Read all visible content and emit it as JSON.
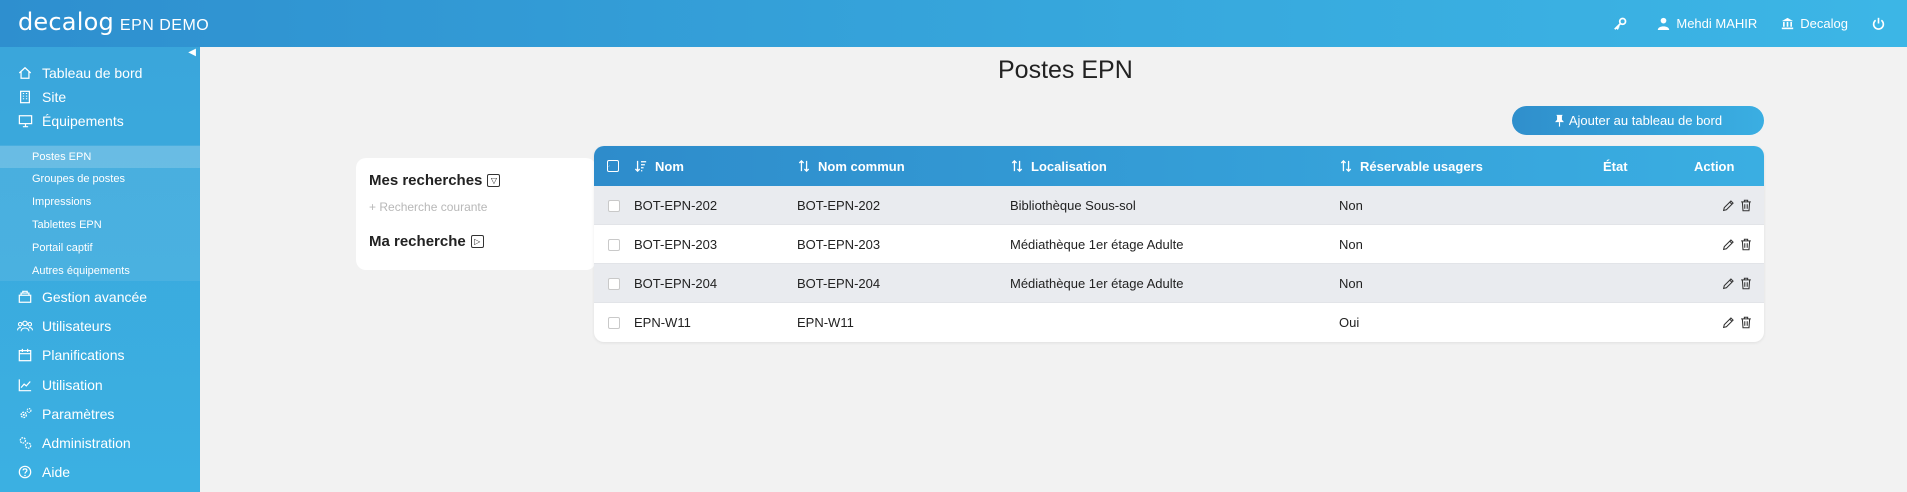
{
  "header": {
    "logo": "decalog",
    "app_name": "EPN DEMO",
    "user": "Mehdi MAHIR",
    "library": "Decalog"
  },
  "sidebar": {
    "items": [
      {
        "label": "Tableau de bord",
        "icon": "home-icon"
      },
      {
        "label": "Site",
        "icon": "building-icon"
      },
      {
        "label": "Équipements",
        "icon": "monitor-icon"
      },
      {
        "label": "Gestion avancée",
        "icon": "layers-icon"
      },
      {
        "label": "Utilisateurs",
        "icon": "users-icon"
      },
      {
        "label": "Planifications",
        "icon": "calendar-icon"
      },
      {
        "label": "Utilisation",
        "icon": "chart-icon"
      },
      {
        "label": "Paramètres",
        "icon": "gears-icon"
      },
      {
        "label": "Administration",
        "icon": "admin-gears-icon"
      },
      {
        "label": "Aide",
        "icon": "help-icon"
      }
    ],
    "subitems": [
      {
        "label": "Postes EPN",
        "active": true
      },
      {
        "label": "Groupes de postes"
      },
      {
        "label": "Impressions"
      },
      {
        "label": "Tablettes EPN"
      },
      {
        "label": "Portail captif"
      },
      {
        "label": "Autres équipements"
      }
    ]
  },
  "main": {
    "title": "Postes EPN",
    "pin_button": "Ajouter au tableau de bord",
    "searches": {
      "mine": "Mes recherches",
      "current": "Recherche courante",
      "my_search": "Ma recherche"
    },
    "table": {
      "columns": [
        "Nom",
        "Nom commun",
        "Localisation",
        "Réservable usagers",
        "État",
        "Action"
      ],
      "rows": [
        {
          "nom": "BOT-EPN-202",
          "nom_commun": "BOT-EPN-202",
          "localisation": "Bibliothèque Sous-sol",
          "reservable": "Non",
          "etat": ""
        },
        {
          "nom": "BOT-EPN-203",
          "nom_commun": "BOT-EPN-203",
          "localisation": "Médiathèque 1er étage Adulte",
          "reservable": "Non",
          "etat": ""
        },
        {
          "nom": "BOT-EPN-204",
          "nom_commun": "BOT-EPN-204",
          "localisation": "Médiathèque 1er étage Adulte",
          "reservable": "Non",
          "etat": ""
        },
        {
          "nom": "EPN-W11",
          "nom_commun": "EPN-W11",
          "localisation": "",
          "reservable": "Oui",
          "etat": ""
        }
      ]
    }
  }
}
